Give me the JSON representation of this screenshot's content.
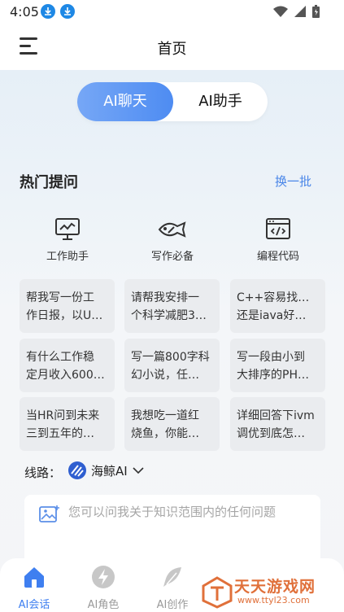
{
  "status_bar": {
    "time": "4:05"
  },
  "header": {
    "title": "首页"
  },
  "mode_toggle": {
    "active": "AI聊天",
    "inactive": "AI助手"
  },
  "hot": {
    "title": "热门提问",
    "refresh": "换一批",
    "categories": [
      {
        "label": "工作助手",
        "icon": "monitor-chart-icon"
      },
      {
        "label": "写作必备",
        "icon": "fish-pen-icon"
      },
      {
        "label": "编程代码",
        "icon": "code-window-icon"
      }
    ],
    "cards": [
      {
        "line1": "帮我写一份工",
        "line2": "作日报，以U…"
      },
      {
        "line1": "请帮我安排一",
        "line2": "个科学减肥3…"
      },
      {
        "line1": "C++容易找工作",
        "line2": "还是iava好…"
      },
      {
        "line1": "有什么工作稳",
        "line2": "定月收入600…"
      },
      {
        "line1": "写一篇800字科",
        "line2": "幻小说，任…"
      },
      {
        "line1": "写一段由小到",
        "line2": "大排序的PH…"
      },
      {
        "line1": "当HR问到未来",
        "line2": "三到五年的…"
      },
      {
        "line1": "我想吃一道红",
        "line2": "烧鱼，你能…"
      },
      {
        "line1": "详细回答下ivm",
        "line2": "调优到底怎…"
      }
    ]
  },
  "route": {
    "label": "线路：",
    "selected": "海鲸AI"
  },
  "input": {
    "placeholder": "您可以问我关于知识范围内的任何问题"
  },
  "bottom_nav": [
    {
      "label": "AI会话",
      "icon": "home-icon",
      "active": true
    },
    {
      "label": "AI角色",
      "icon": "lightning-icon",
      "active": false
    },
    {
      "label": "AI创作",
      "icon": "feather-icon",
      "active": false
    }
  ],
  "watermark": {
    "title": "天天游戏网",
    "url": "www.ttyl23.com"
  },
  "colors": {
    "accent": "#4e8cf2",
    "link": "#4a86e8",
    "card_bg": "#eaecef",
    "watermark": "#e0703a"
  }
}
